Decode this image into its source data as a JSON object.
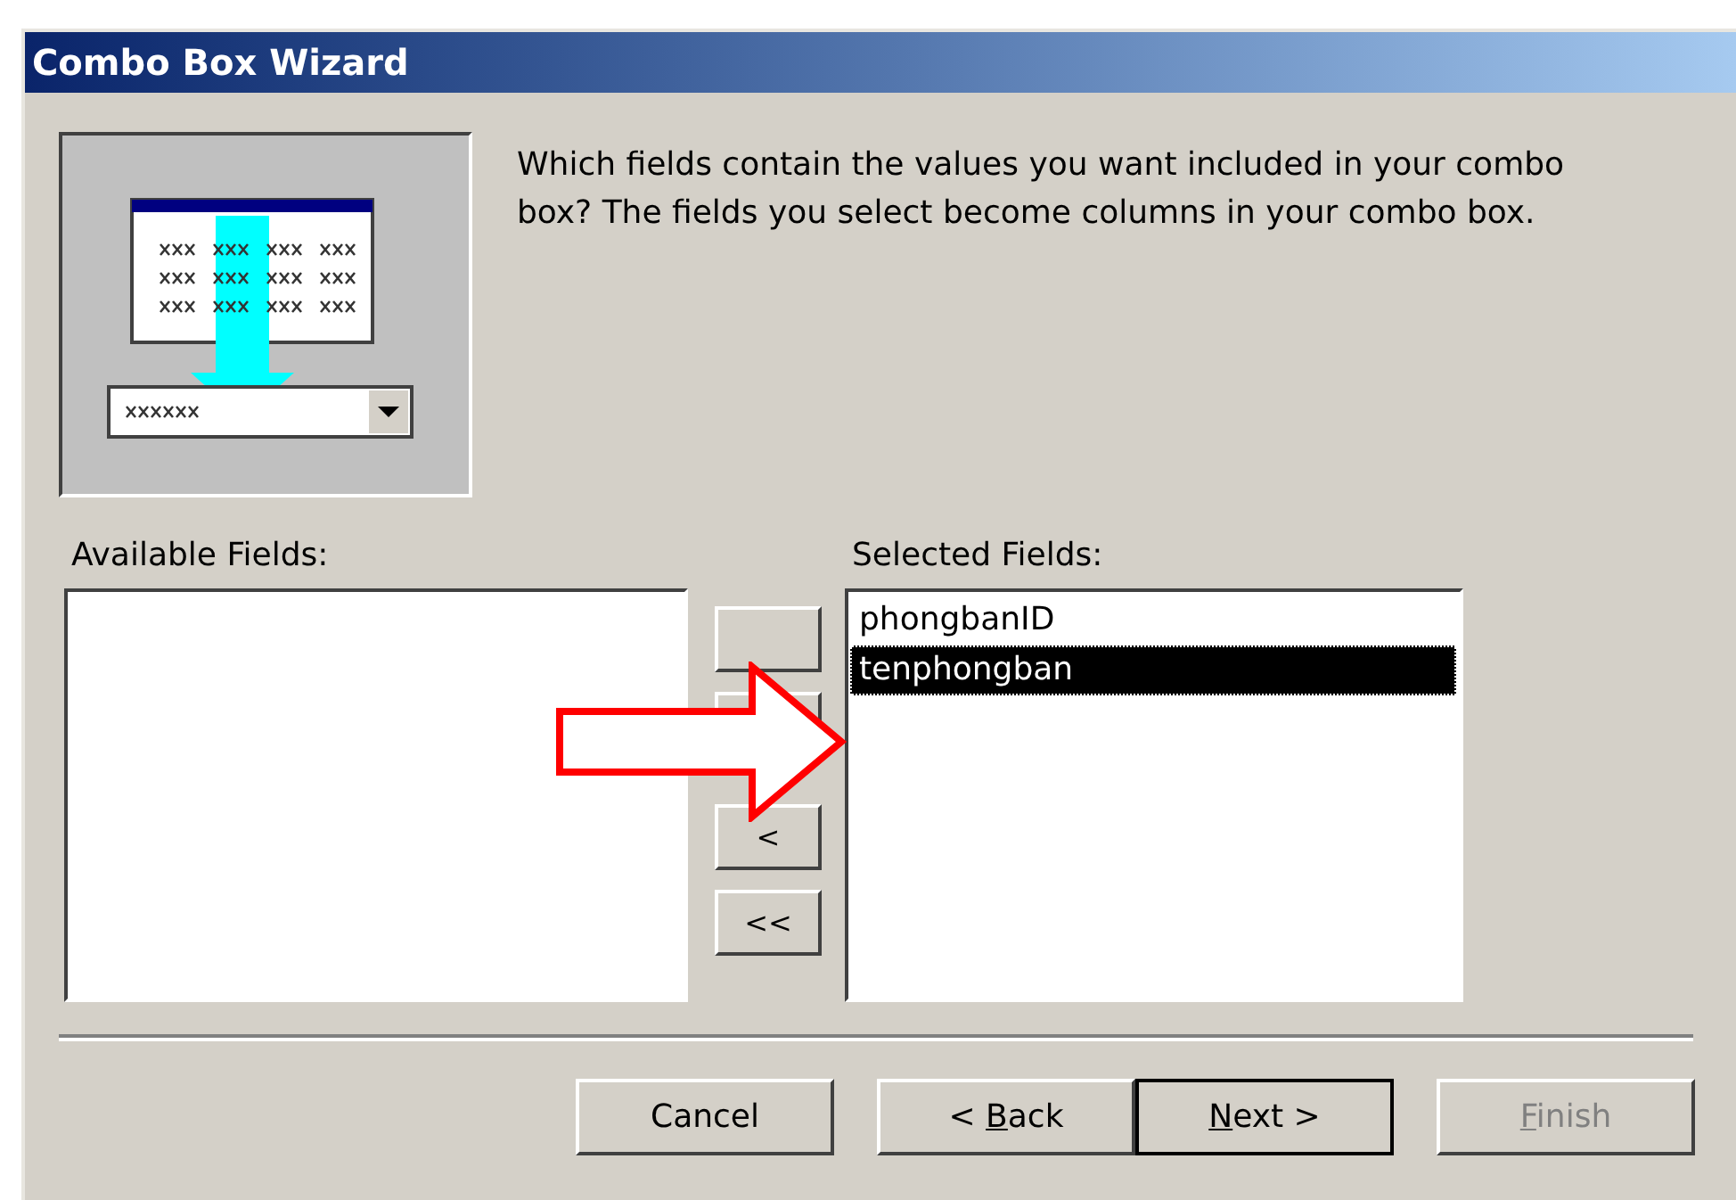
{
  "window": {
    "title": "Combo Box Wizard"
  },
  "prompt": "Which fields contain the values you want included in your combo box? The fields you select become columns in your combo box.",
  "available": {
    "label": "Available Fields:"
  },
  "move_buttons": [
    {
      "label": "<"
    },
    {
      "label": "<<"
    }
  ],
  "selected": {
    "label": "Selected Fields:",
    "items": [
      {
        "text": "phongbanID",
        "selected": false
      },
      {
        "text": "tenphongban",
        "selected": true
      }
    ]
  },
  "buttons": [
    {
      "post": "Cancel",
      "default": false,
      "disabled": false
    },
    {
      "pre": "< ",
      "key": "B",
      "post": "ack",
      "default": false,
      "disabled": false
    },
    {
      "key": "N",
      "post": "ext >",
      "default": true,
      "disabled": false
    },
    {
      "key": "F",
      "post": "inish",
      "default": false,
      "disabled": true
    }
  ]
}
